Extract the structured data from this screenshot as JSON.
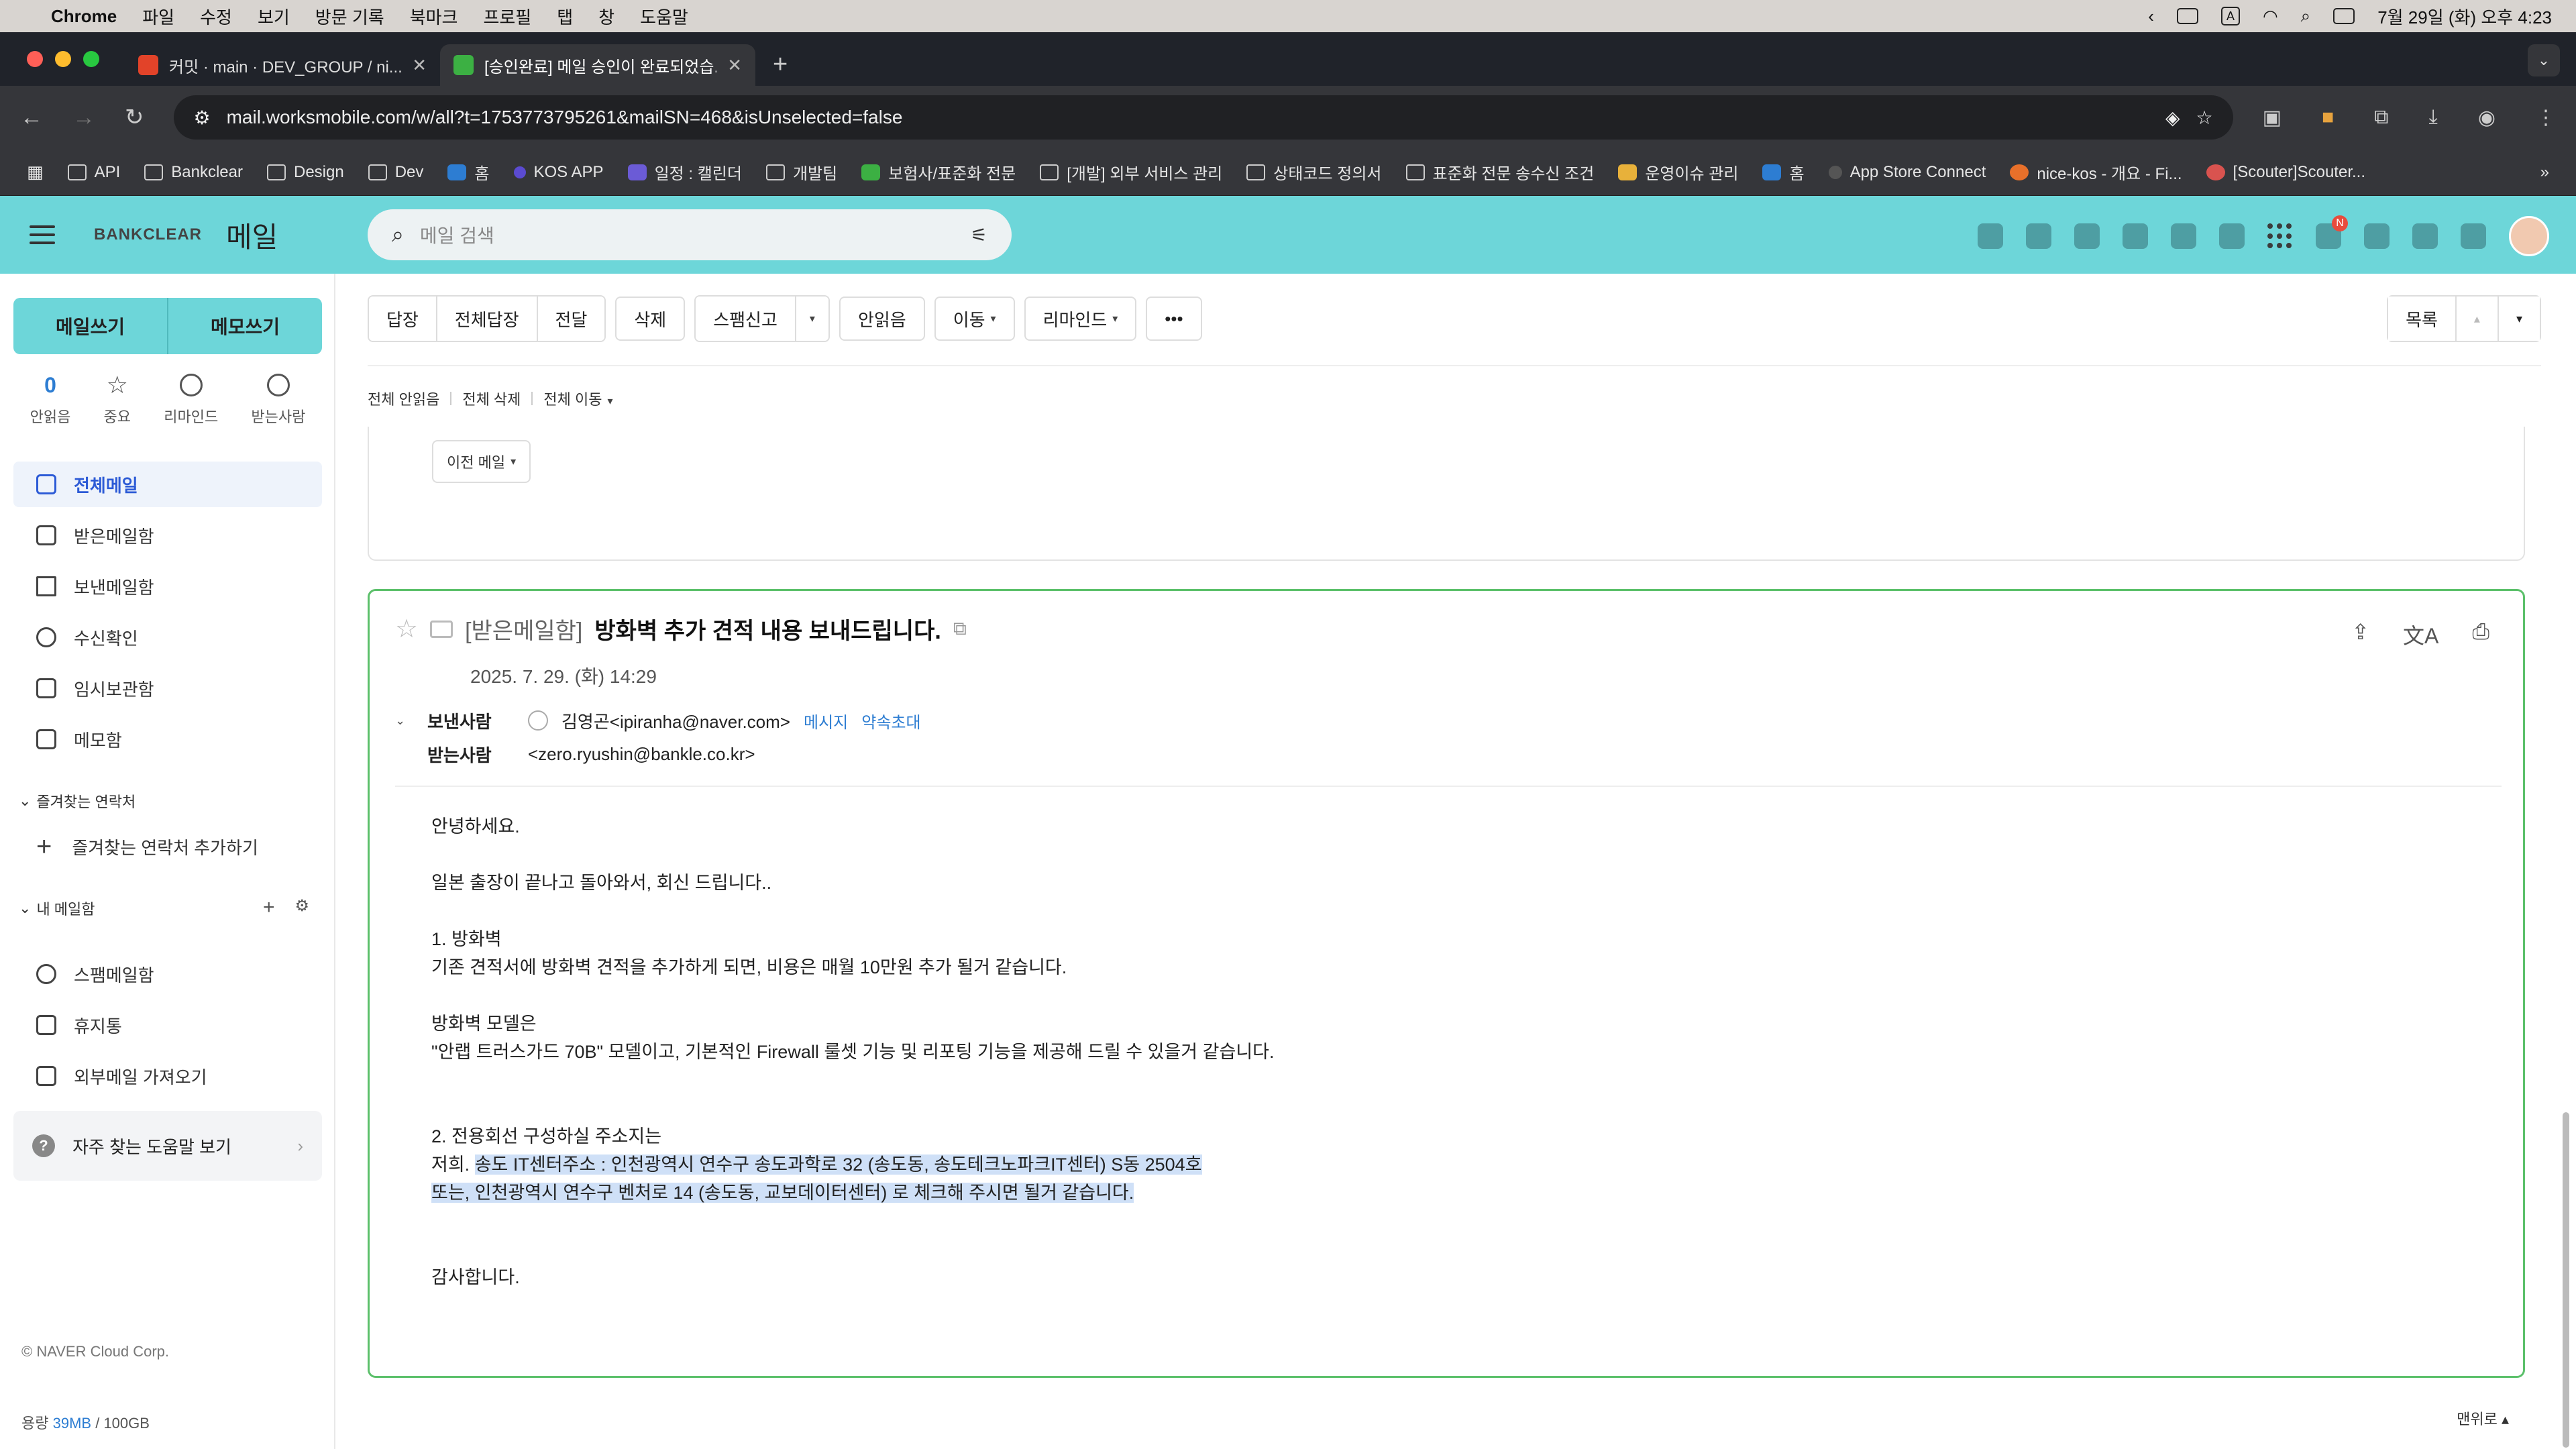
{
  "os": {
    "app": "Chrome",
    "menus": [
      "파일",
      "수정",
      "보기",
      "방문 기록",
      "북마크",
      "프로필",
      "탭",
      "창",
      "도움말"
    ],
    "clock": "7월 29일 (화) 오후 4:23"
  },
  "tabs": [
    {
      "title": "커밋 · main · DEV_GROUP / ni...",
      "active": false,
      "fav_color": "#e24329"
    },
    {
      "title": "[승인완료] 메일 승인이 완료되었습...",
      "active": true,
      "fav_color": "#3cb043"
    }
  ],
  "address": {
    "url": "mail.worksmobile.com/w/all?t=1753773795261&mailSN=468&isUnselected=false"
  },
  "bookmarks": [
    "API",
    "Bankclear",
    "Design",
    "Dev",
    "홈",
    "KOS APP",
    "일정 : 캘린더",
    "개발팀",
    "보험사/표준화 전문",
    "[개발] 외부 서비스 관리",
    "상태코드 정의서",
    "표준화 전문 송수신 조건",
    "운영이슈 관리",
    "홈",
    "App Store Connect",
    "nice-kos - 개요 - Fi...",
    "[Scouter]Scouter..."
  ],
  "header": {
    "brand": "BANKCLEAR",
    "app_name": "메일",
    "search_placeholder": "메일 검색",
    "notification_badge": "N",
    "accent": "#6dd6d9"
  },
  "sidebar": {
    "write_label": "메일쓰기",
    "memo_label": "메모쓰기",
    "quick": [
      {
        "value": "0",
        "label": "안읽음"
      },
      {
        "label": "중요"
      },
      {
        "label": "리마인드"
      },
      {
        "label": "받는사람"
      }
    ],
    "folders": [
      "전체메일",
      "받은메일함",
      "보낸메일함",
      "수신확인",
      "임시보관함",
      "메모함"
    ],
    "fav_section": "즐겨찾는 연락처",
    "add_fav": "즐겨찾는 연락처 추가하기",
    "my_mail_section": "내 메일함",
    "my_folders": [
      "스팸메일함",
      "휴지통",
      "외부메일 가져오기"
    ],
    "help": "자주 찾는 도움말 보기",
    "copyright": "© NAVER Cloud Corp.",
    "storage_label": "용량",
    "storage_used": "39MB",
    "storage_total": "/ 100GB"
  },
  "toolbar": {
    "group1": [
      "답장",
      "전체답장",
      "전달"
    ],
    "delete": "삭제",
    "spam": "스팸신고",
    "unread": "안읽음",
    "move": "이동",
    "remind": "리마인드",
    "more": "•••",
    "list": "목록"
  },
  "sub_actions": [
    "전체 안읽음",
    "전체 삭제",
    "전체 이동"
  ],
  "prev_mail": "이전 메일",
  "mail": {
    "folder_tag": "[받은메일함]",
    "subject": "방화벽 추가 견적 내용 보내드립니다.",
    "date": "2025. 7. 29. (화) 14:29",
    "from_label": "보낸사람",
    "from": "김영곤<ipiranha@naver.com>",
    "from_links": [
      "메시지",
      "약속초대"
    ],
    "to_label": "받는사람",
    "to": "<zero.ryushin@bankle.co.kr>",
    "body": {
      "l1": "안녕하세요.",
      "l2": "일본 출장이 끝나고 돌아와서, 회신 드립니다..",
      "l3": "1. 방화벽",
      "l4": "기존 견적서에 방화벽 견적을 추가하게 되면, 비용은 매월 10만원 추가 될거 같습니다.",
      "l5": "방화벽 모델은",
      "l6": "\"안랩 트러스가드 70B\" 모델이고, 기본적인 Firewall 룰셋 기능 및 리포팅 기능을 제공해 드릴 수 있을거 같습니다.",
      "l7": "2. 전용회선 구성하실 주소지는",
      "l8a": "저희. ",
      "l8b": "송도 IT센터주소 : 인천광역시 연수구 송도과학로 32 (송도동, 송도테크노파크IT센터) S동 2504호",
      "l9": "또는, 인천광역시 연수구 벤처로 14 (송도동, 교보데이터센터) 로 체크해 주시면 될거 같습니다.",
      "l10": "감사합니다."
    }
  },
  "top_link": "맨위로 ▴"
}
